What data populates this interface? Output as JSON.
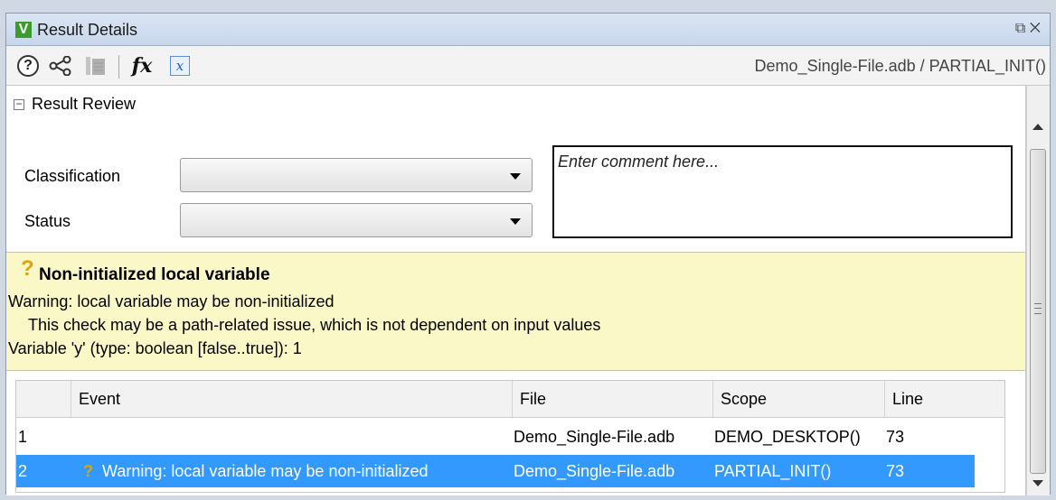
{
  "window": {
    "title": "Result Details",
    "breadcrumb": "Demo_Single-File.adb / PARTIAL_INIT()"
  },
  "toolbar": {
    "icons": [
      "help-icon",
      "graph-icon",
      "stack-icon",
      "fx-icon",
      "variable-icon"
    ],
    "fx_label": "fx",
    "var_label": "x"
  },
  "review": {
    "header": "Result Review",
    "classification_label": "Classification",
    "classification_value": "",
    "status_label": "Status",
    "status_value": "",
    "comment_placeholder": "Enter comment here..."
  },
  "warning": {
    "icon": "?",
    "title": "Non-initialized local variable",
    "line1": "Warning: local variable may be non-initialized",
    "line2": "This check may be a path-related issue, which is not dependent on input values",
    "line3": "Variable 'y' (type: boolean [false..true]): 1"
  },
  "table": {
    "columns": [
      "Event",
      "File",
      "Scope",
      "Line"
    ],
    "rows": [
      {
        "num": "1",
        "event": "",
        "file": "Demo_Single-File.adb",
        "scope": "DEMO_DESKTOP()",
        "line": "73"
      },
      {
        "num": "2",
        "event": "Warning: local variable may be non-initialized",
        "file": "Demo_Single-File.adb",
        "scope": "PARTIAL_INIT()",
        "line": "73"
      }
    ]
  },
  "colors": {
    "warning_bg": "#fbf8c7",
    "selection": "#3399ff",
    "question_mark": "#e0a300"
  }
}
